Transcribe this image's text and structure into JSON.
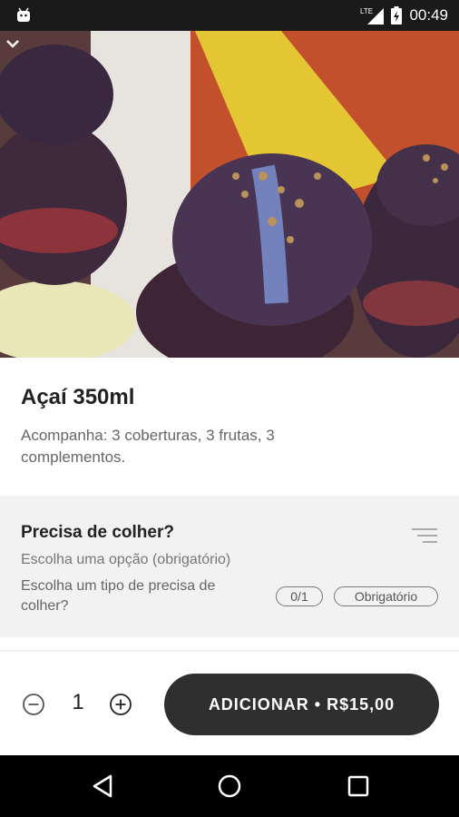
{
  "status_bar": {
    "time": "00:49",
    "network": "LTE"
  },
  "product": {
    "title": "Açaí  350ml",
    "description": "Acompanha: 3 coberturas, 3 frutas, 3 complementos."
  },
  "option_group": {
    "title": "Precisa de colher?",
    "subtitle": "Escolha uma opção (obrigatório)",
    "question": "Escolha um tipo de precisa de colher?",
    "count_badge": "0/1",
    "required_badge": "Obrigatório"
  },
  "cart": {
    "quantity": "1",
    "add_button_label": "ADICIONAR • R$15,00"
  },
  "icons": {
    "collapse": "chevron-down-icon",
    "filter": "filter-icon",
    "minus": "minus-circle-icon",
    "plus": "plus-circle-icon",
    "nav_back": "back-triangle-icon",
    "nav_home": "home-circle-icon",
    "nav_recents": "recents-square-icon"
  }
}
